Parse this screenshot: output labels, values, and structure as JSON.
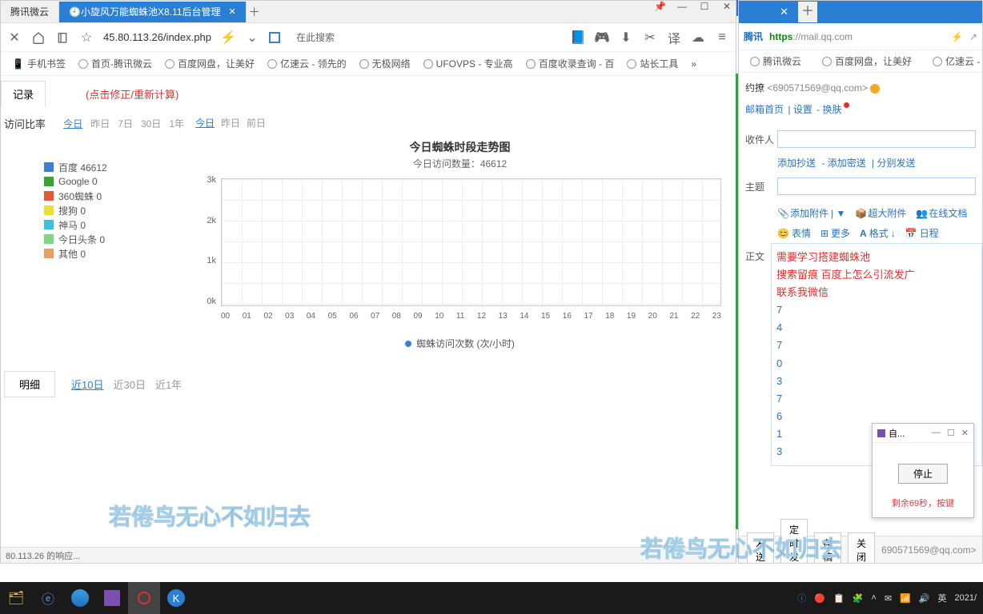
{
  "left": {
    "tabs": [
      "腾讯微云",
      "小旋风万能蜘蛛池X8.11后台管理"
    ],
    "address": "45.80.113.26/index.php",
    "search_hint": "在此搜索",
    "bookmarks": [
      "手机书签",
      "首页-腾讯微云",
      "百度网盘，让美好",
      "亿速云 - 领先的",
      "无极网络",
      "UFOVPS - 专业高",
      "百度收录查询 - 百",
      "站长工具"
    ],
    "top_tab": "记录",
    "red_hint": "(点击修正/重新计算)",
    "ratio_title": "访问比率",
    "ratio_links": [
      "今日",
      "昨日",
      "7日",
      "30日",
      "1年"
    ],
    "trend_links": [
      "今日",
      "昨日",
      "前日"
    ],
    "legend": [
      {
        "label": "百度 46612",
        "color": "#3b7dd8"
      },
      {
        "label": "Google 0",
        "color": "#3aa235"
      },
      {
        "label": "360蜘蛛 0",
        "color": "#e25b32"
      },
      {
        "label": "搜狗 0",
        "color": "#e8e035"
      },
      {
        "label": "神马 0",
        "color": "#3cc0e0"
      },
      {
        "label": "今日头条 0",
        "color": "#7fd87f"
      },
      {
        "label": "其他 0",
        "color": "#e8a060"
      }
    ],
    "detail_tab": "明细",
    "detail_links": [
      "近10日",
      "近30日",
      "近1年"
    ],
    "status": "80.113.26 的响应...",
    "watermark": "若倦鸟无心不如归去"
  },
  "chart_data": {
    "type": "line",
    "title": "今日蜘蛛时段走势图",
    "subtitle": "今日访问数量：46612",
    "xlabel": "",
    "ylabel": "",
    "y_ticks": [
      "3k",
      "2k",
      "1k",
      "0k"
    ],
    "categories": [
      "00",
      "01",
      "02",
      "03",
      "04",
      "05",
      "06",
      "07",
      "08",
      "09",
      "10",
      "11",
      "12",
      "13",
      "14",
      "15",
      "16",
      "17",
      "18",
      "19",
      "20",
      "21",
      "22",
      "23"
    ],
    "series": [
      {
        "name": "蜘蛛访问次数 (次/小时)",
        "values": [
          0,
          0,
          0,
          0,
          0,
          0,
          0,
          0,
          0,
          0,
          0,
          0,
          0,
          0,
          0,
          0,
          0,
          0,
          0,
          0,
          0,
          0,
          0,
          0
        ]
      }
    ],
    "ylim": [
      0,
      3000
    ],
    "legend_bottom": "蜘蛛访问次数 (次/小时)"
  },
  "right": {
    "brand": "腾讯",
    "domain": "https://mail.qq.com",
    "bookmarks": [
      "腾讯微云",
      "百度网盘，让美好",
      "亿速云 - 领先的"
    ],
    "user_name": "约撩",
    "user_email": "<690571569@qq.com>",
    "subnav": [
      "邮箱首页",
      "设置",
      "换肤"
    ],
    "to_label": "收件人",
    "cc_links": [
      "添加抄送",
      "添加密送",
      "分别发送"
    ],
    "subject_label": "主题",
    "attachments": [
      "添加附件",
      "超大附件",
      "在线文档"
    ],
    "format": [
      "表情",
      "更多",
      "格式",
      "日程"
    ],
    "body_label": "正文",
    "body_lines": [
      "需要学习搭建蜘蛛池",
      "搜索留痕   百度上怎么引流发广",
      "联系我微信"
    ],
    "phone_digits": [
      "7",
      "4",
      "7",
      "0",
      "3",
      "7",
      "6",
      "1",
      "3"
    ],
    "popup_title": "自...",
    "popup_btn": "停止",
    "popup_msg": "剩余69秒，按键",
    "footer_btns": [
      "发送",
      "定时发送",
      "存稿",
      "关闭"
    ],
    "footer_info": "690571569@qq.com>"
  },
  "taskbar": {
    "clock": "2021/",
    "lang": "英"
  }
}
